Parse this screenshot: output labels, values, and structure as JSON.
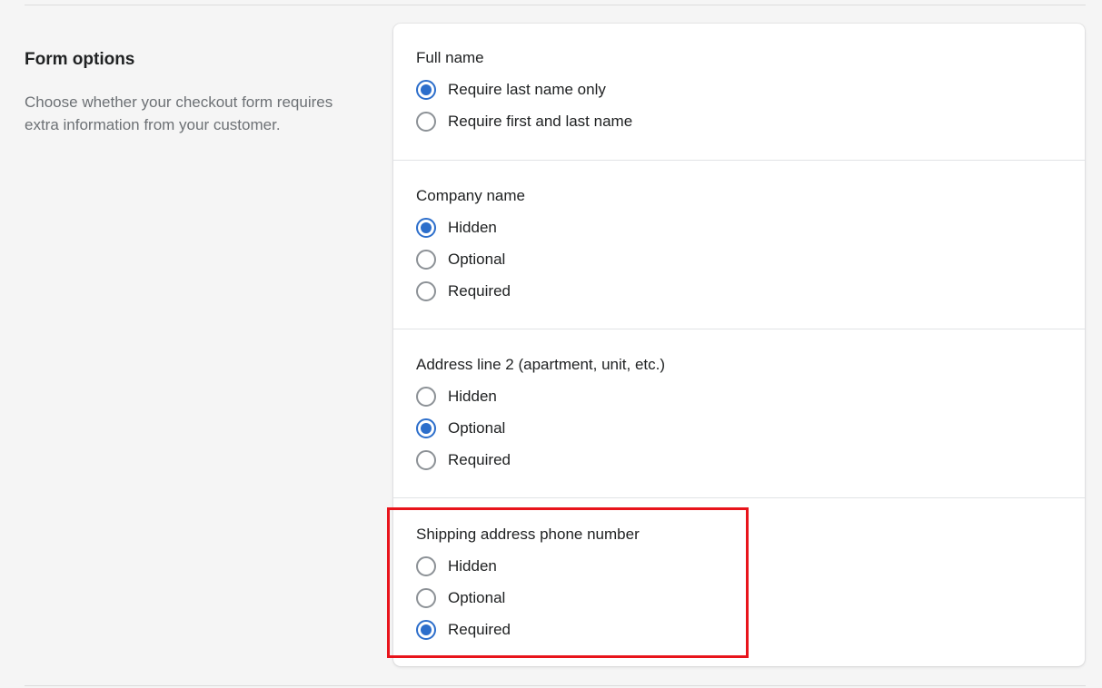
{
  "annotation": {
    "title": "Form options",
    "description": "Choose whether your checkout form requires extra information from your customer."
  },
  "sections": [
    {
      "title": "Full name",
      "options": [
        {
          "label": "Require last name only",
          "selected": true
        },
        {
          "label": "Require first and last name",
          "selected": false
        }
      ]
    },
    {
      "title": "Company name",
      "options": [
        {
          "label": "Hidden",
          "selected": true
        },
        {
          "label": "Optional",
          "selected": false
        },
        {
          "label": "Required",
          "selected": false
        }
      ]
    },
    {
      "title": "Address line 2 (apartment, unit, etc.)",
      "options": [
        {
          "label": "Hidden",
          "selected": false
        },
        {
          "label": "Optional",
          "selected": true
        },
        {
          "label": "Required",
          "selected": false
        }
      ]
    },
    {
      "title": "Shipping address phone number",
      "options": [
        {
          "label": "Hidden",
          "selected": false
        },
        {
          "label": "Optional",
          "selected": false
        },
        {
          "label": "Required",
          "selected": true
        }
      ]
    }
  ],
  "colors": {
    "accent": "#2c6ecb",
    "highlight": "#e8141b"
  }
}
